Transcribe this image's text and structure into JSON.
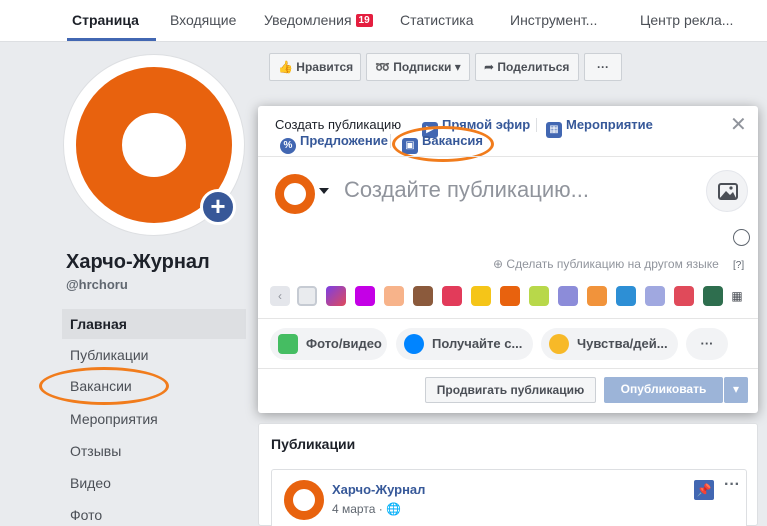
{
  "nav": {
    "tabs": [
      {
        "label": "Страница",
        "active": true
      },
      {
        "label": "Входящие"
      },
      {
        "label": "Уведомления",
        "badge": "19"
      },
      {
        "label": "Статистика"
      },
      {
        "label": "Инструмент..."
      },
      {
        "label": "Центр рекла..."
      }
    ]
  },
  "page": {
    "name": "Харчо-Журнал",
    "handle": "@hrchoru"
  },
  "sidebar": {
    "items": [
      {
        "label": "Главная",
        "active": true
      },
      {
        "label": "Публикации"
      },
      {
        "label": "Вакансии"
      },
      {
        "label": "Мероприятия"
      },
      {
        "label": "Отзывы"
      },
      {
        "label": "Видео"
      },
      {
        "label": "Фото"
      }
    ]
  },
  "actions": {
    "like": "Нравится",
    "subscriptions": "Подписки",
    "share": "Поделиться",
    "more": "···"
  },
  "composer": {
    "tabs": {
      "create": "Создать публикацию",
      "live": "Прямой эфир",
      "event": "Мероприятие",
      "offer": "Предложение",
      "job": "Вакансия"
    },
    "placeholder": "Создайте публикацию...",
    "other_language": "Сделать публикацию на другом языке",
    "help": "[?]",
    "buttons": {
      "photo": "Фото/видео",
      "messenger": "Получайте с...",
      "feelings": "Чувства/дей...",
      "more": "···"
    },
    "boost": "Продвигать публикацию",
    "publish": "Опубликовать"
  },
  "posts": {
    "title": "Публикации",
    "item": {
      "author": "Харчо-Журнал",
      "date": "4 марта"
    }
  },
  "colors": {
    "accent": "#4267b2",
    "brand_orange": "#e8620e",
    "highlight_oval": "#f17c1c",
    "link": "#365899"
  },
  "icons": {
    "background_swatches": [
      "#e9ebee",
      "#7b3fe4",
      "#c400e6",
      "#f7b38a",
      "#8b5a3c",
      "#e23b5a",
      "#f5c518",
      "#e8620e",
      "#b8d84a",
      "#8c8cd9",
      "#f1933b",
      "#2d8fd5",
      "#a0a8e0",
      "#e04a5a",
      "#2e6e4e"
    ]
  }
}
